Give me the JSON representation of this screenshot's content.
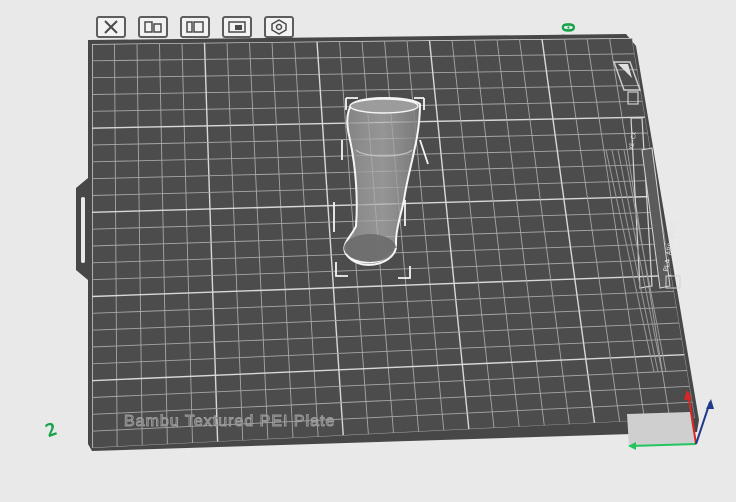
{
  "plate": {
    "number": "01",
    "label": "Bambu Textured PEI Plate",
    "left_mark": "2"
  },
  "toolbar": [
    {
      "name": "close-plate-button",
      "icon": "close-icon"
    },
    {
      "name": "arrange-button",
      "icon": "arrange-icon"
    },
    {
      "name": "orient-button",
      "icon": "orient-icon"
    },
    {
      "name": "lock-plate-button",
      "icon": "lock-icon"
    },
    {
      "name": "plate-settings-button",
      "icon": "settings-icon"
    }
  ],
  "side_panel": {
    "tag_top": "XE-CX",
    "filament_text": "PLA ABS PETG"
  },
  "colors": {
    "plate": "#4c4c4c",
    "grid": "#bfbfbf",
    "background": "#e9e9ea",
    "accent_green": "#16a34a",
    "axis_x": "#22c55e",
    "axis_y": "#dc2626",
    "axis_z": "#1e3a8a"
  }
}
